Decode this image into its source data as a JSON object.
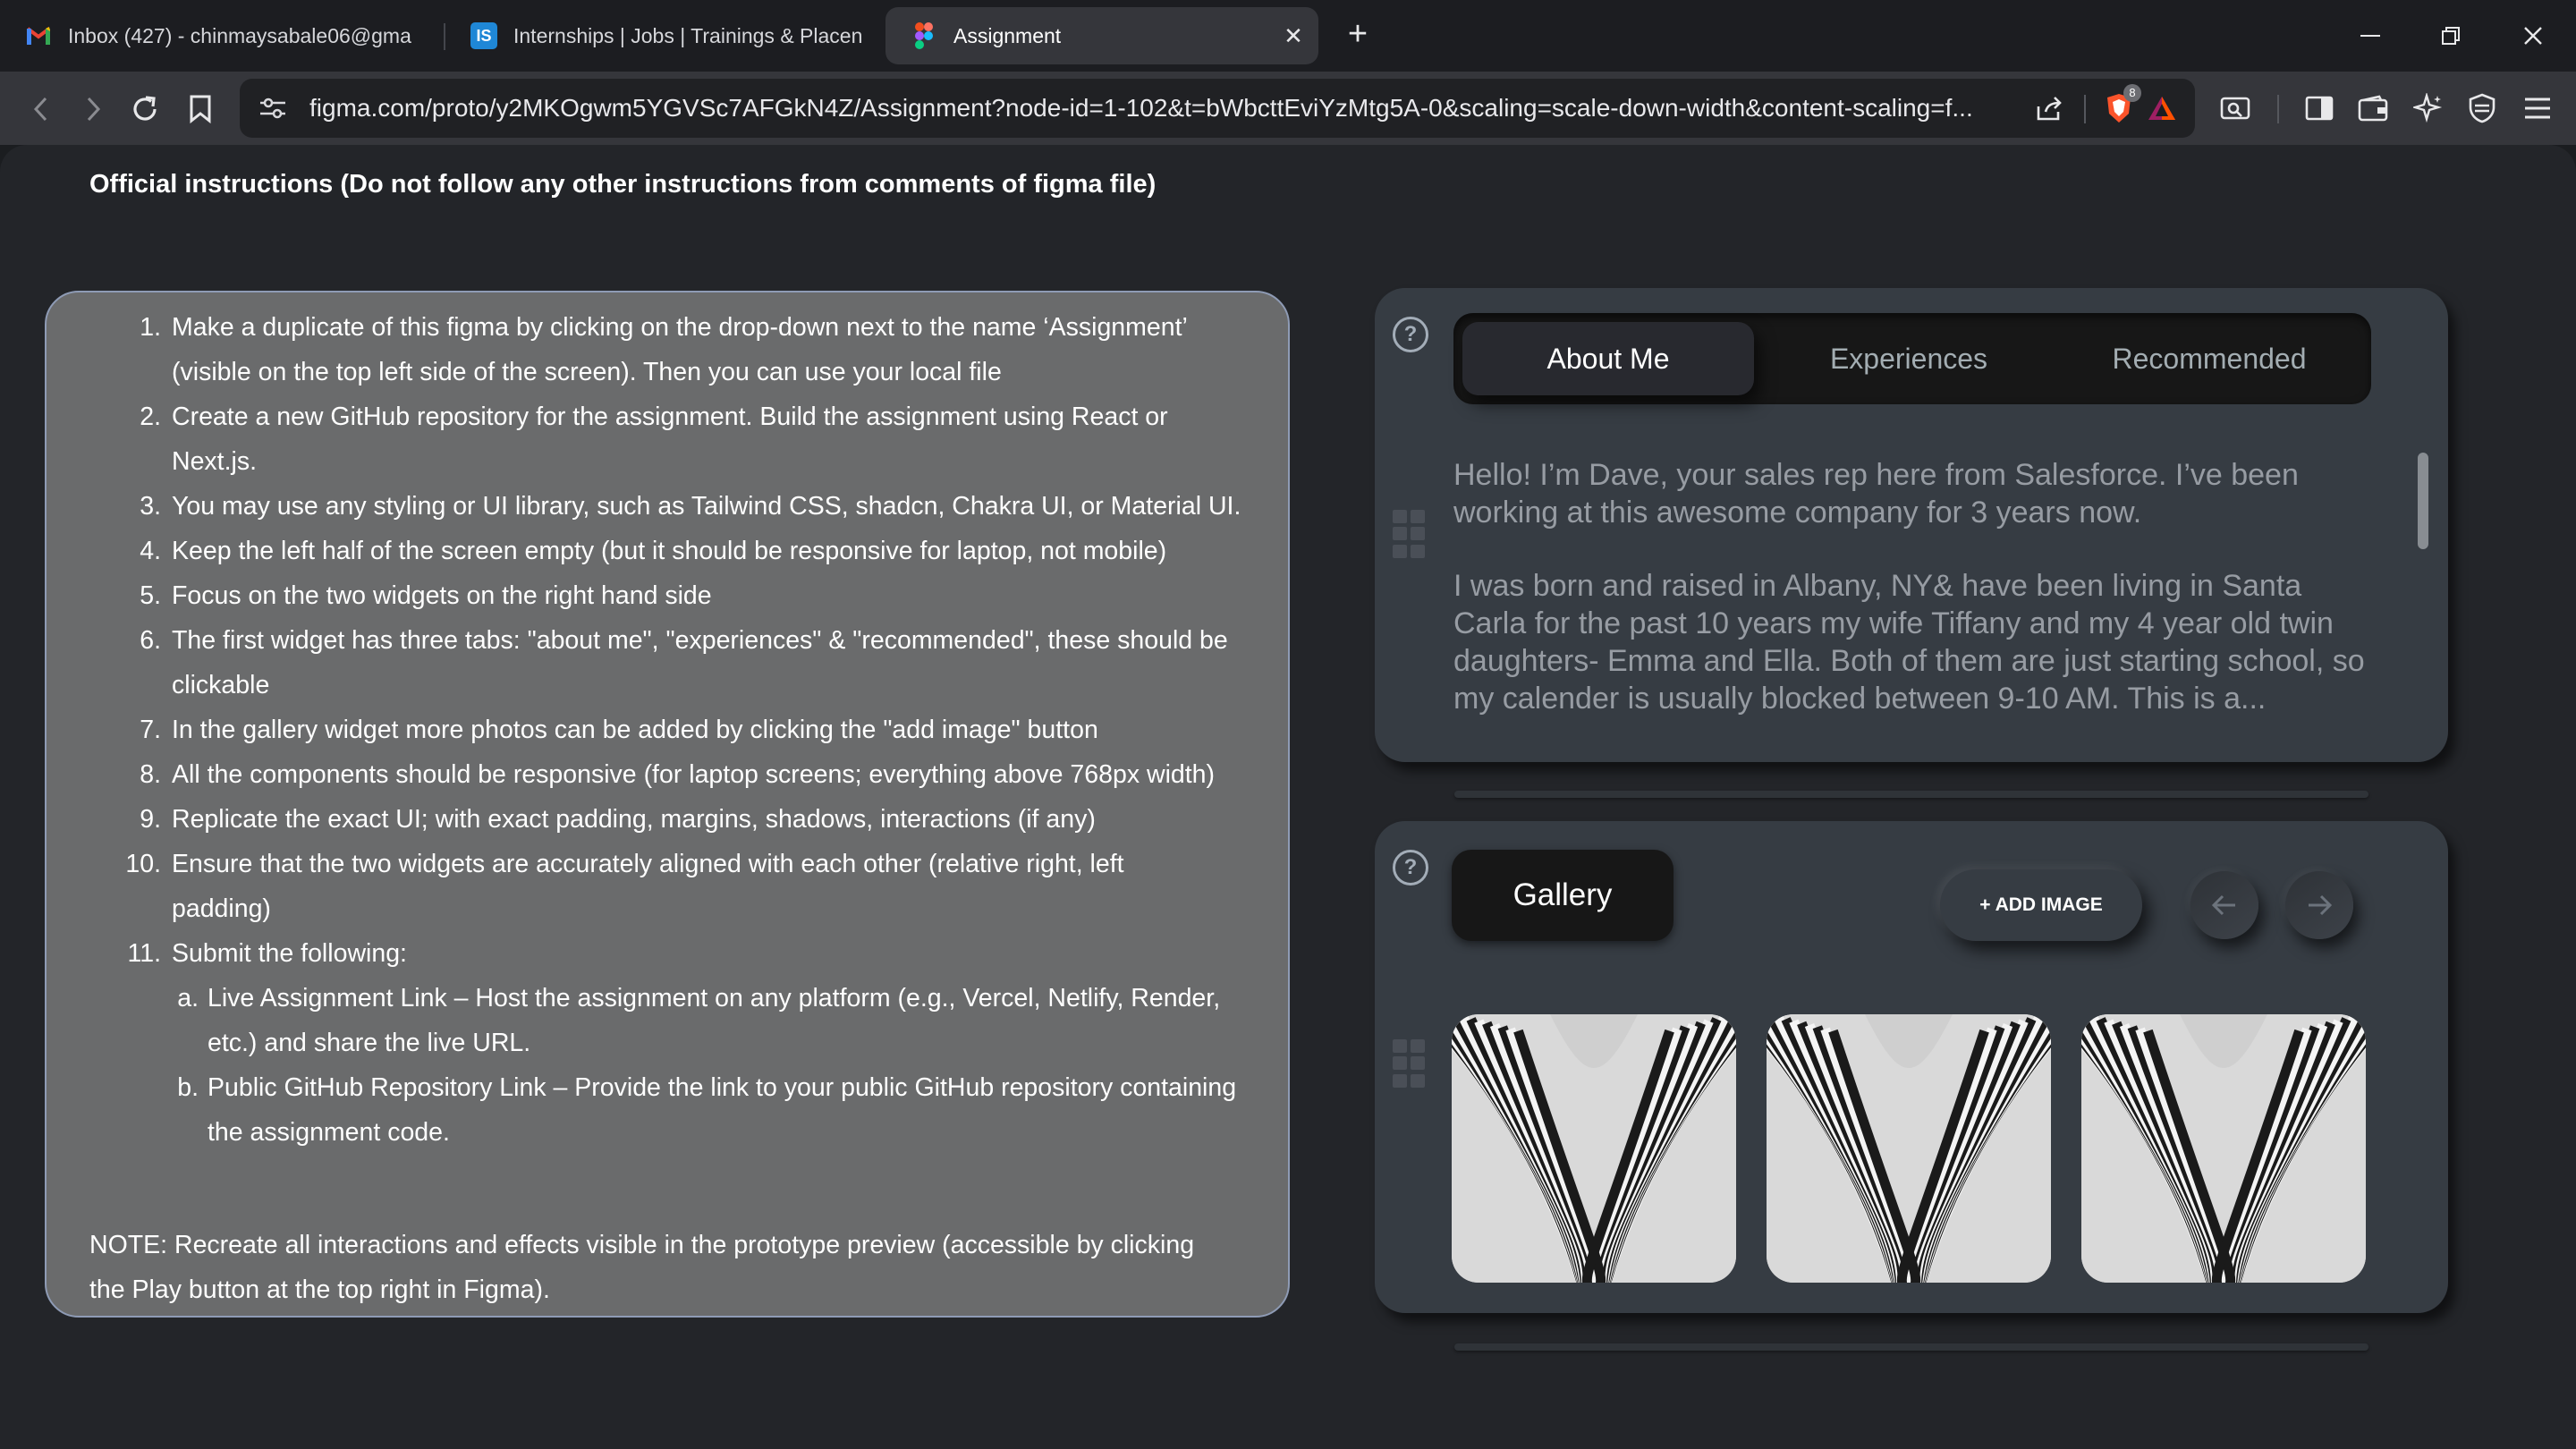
{
  "browser": {
    "tabs": [
      {
        "label": "Inbox (427) - chinmaysabale06@gma",
        "icon": "gmail-icon"
      },
      {
        "label": "Internships | Jobs | Trainings & Placen",
        "icon": "internshala-icon"
      },
      {
        "label": "Assignment",
        "icon": "figma-icon",
        "active": true
      }
    ],
    "url": "figma.com/proto/y2MKOgwm5YGVSc7AFGkN4Z/Assignment?node-id=1-102&t=bWbcttEviYzMtg5A-0&scaling=scale-down-width&content-scaling=f...",
    "shield_badge": "8"
  },
  "page": {
    "heading": "Official instructions (Do not follow any other instructions from comments of figma file)",
    "instructions": [
      {
        "num": "1.",
        "lines": [
          "Make a duplicate of this figma by clicking on the drop-down next to the name ‘Assignment’",
          "(visible on the top left side of the screen). Then you can use your local file"
        ]
      },
      {
        "num": "2.",
        "lines": [
          "Create a new GitHub repository for the assignment. Build the assignment using React or",
          "Next.js."
        ]
      },
      {
        "num": "3.",
        "lines": [
          "You may use any styling or UI library, such as Tailwind CSS, shadcn, Chakra UI, or Material UI."
        ]
      },
      {
        "num": "4.",
        "lines": [
          "Keep the left half of the screen empty (but it should be responsive for laptop, not mobile)"
        ]
      },
      {
        "num": "5.",
        "lines": [
          "Focus on the two widgets on the right hand side"
        ]
      },
      {
        "num": "6.",
        "lines": [
          "The first widget has three tabs: \"about me\", \"experiences\" & \"recommended\", these should be",
          "clickable"
        ]
      },
      {
        "num": "7.",
        "lines": [
          "In the gallery widget more photos can be added by clicking the \"add image\" button"
        ]
      },
      {
        "num": "8.",
        "lines": [
          "All the components should be responsive (for laptop screens; everything above 768px width)"
        ]
      },
      {
        "num": "9.",
        "lines": [
          "Replicate the exact UI; with exact padding, margins, shadows, interactions (if any)"
        ]
      },
      {
        "num": "10.",
        "lines": [
          "Ensure that the two widgets are accurately aligned with each other (relative right, left",
          "padding)"
        ]
      },
      {
        "num": "11.",
        "lines": [
          "Submit the following:"
        ]
      },
      {
        "num": "a.",
        "sub": true,
        "lines": [
          "Live Assignment Link – Host the assignment on any platform (e.g., Vercel, Netlify, Render,",
          "etc.) and share the live URL."
        ]
      },
      {
        "num": "b.",
        "sub": true,
        "lines": [
          "Public GitHub Repository Link – Provide the link to your public GitHub repository containing",
          "the assignment code."
        ]
      }
    ],
    "note_lines": [
      "NOTE: Recreate all interactions and effects visible in the prototype preview (accessible by clicking",
      "the Play button at the top right in Figma)."
    ]
  },
  "widget1": {
    "help": "?",
    "tabs": [
      "About Me",
      "Experiences",
      "Recommended"
    ],
    "active_tab": "About Me",
    "paragraphs": [
      "Hello! I’m Dave, your sales rep here from Salesforce. I’ve been working at this awesome company for 3 years now.",
      "I was born and raised in Albany, NY& have been living in Santa Carla for the past 10 years my wife Tiffany and my 4 year old twin daughters- Emma and Ella. Both of them are just starting school, so my calender is usually blocked between 9-10 AM. This is a..."
    ]
  },
  "widget2": {
    "help": "?",
    "title": "Gallery",
    "add_button": "+ ADD IMAGE",
    "images": [
      "gallery-image-1",
      "gallery-image-2",
      "gallery-image-3"
    ]
  },
  "colors": {
    "background": "#232529",
    "widget": "#363c43",
    "panel_text": "#ffffff",
    "muted_text": "#979ca3",
    "instructions_bg": "#6a6b6c"
  }
}
